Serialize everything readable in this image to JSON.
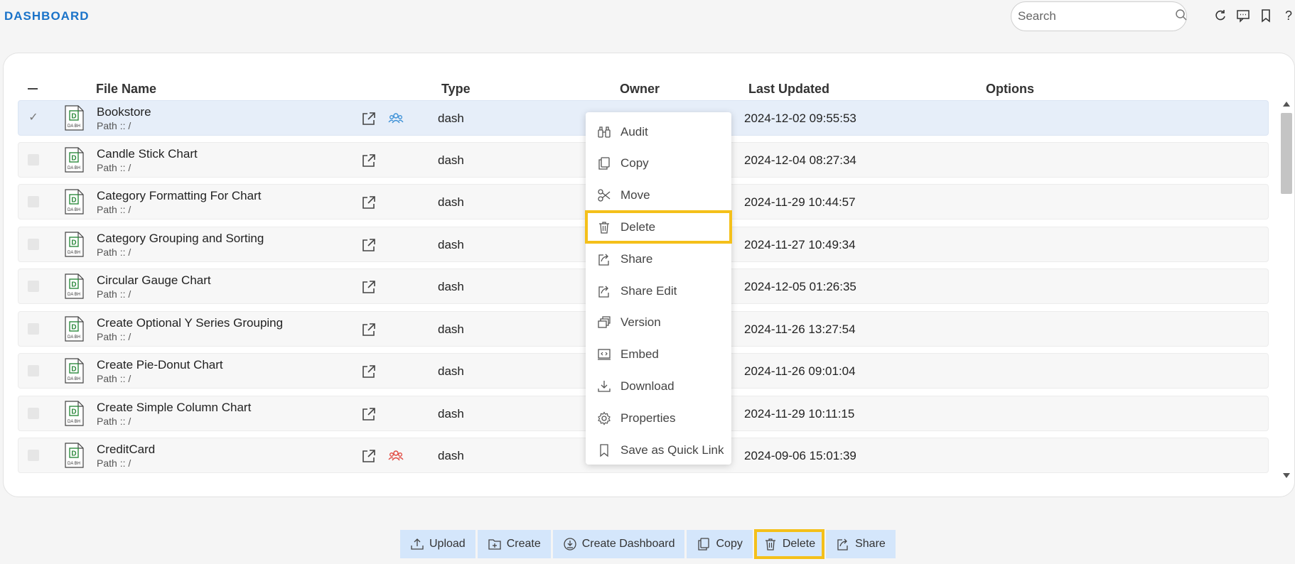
{
  "header": {
    "title": "DASHBOARD",
    "search_placeholder": "Search",
    "icons": [
      "refresh-icon",
      "comment-icon",
      "bookmark-icon",
      "help-icon"
    ]
  },
  "table": {
    "columns": {
      "file_name": "File Name",
      "type": "Type",
      "owner": "Owner",
      "last_updated": "Last Updated",
      "options": "Options"
    },
    "rows": [
      {
        "name": "Bookstore",
        "path": "Path :: /",
        "type": "dash",
        "updated": "2024-12-02 09:55:53",
        "selected": true,
        "shared": "blue"
      },
      {
        "name": "Candle Stick Chart",
        "path": "Path :: /",
        "type": "dash",
        "updated": "2024-12-04 08:27:34",
        "selected": false,
        "shared": ""
      },
      {
        "name": "Category Formatting For Chart",
        "path": "Path :: /",
        "type": "dash",
        "updated": "2024-11-29 10:44:57",
        "selected": false,
        "shared": ""
      },
      {
        "name": "Category Grouping and Sorting",
        "path": "Path :: /",
        "type": "dash",
        "updated": "2024-11-27 10:49:34",
        "selected": false,
        "shared": ""
      },
      {
        "name": "Circular Gauge Chart",
        "path": "Path :: /",
        "type": "dash",
        "updated": "2024-12-05 01:26:35",
        "selected": false,
        "shared": ""
      },
      {
        "name": "Create Optional Y Series Grouping",
        "path": "Path :: /",
        "type": "dash",
        "updated": "2024-11-26 13:27:54",
        "selected": false,
        "shared": ""
      },
      {
        "name": "Create Pie-Donut Chart",
        "path": "Path :: /",
        "type": "dash",
        "updated": "2024-11-26 09:01:04",
        "selected": false,
        "shared": ""
      },
      {
        "name": "Create Simple Column Chart",
        "path": "Path :: /",
        "type": "dash",
        "updated": "2024-11-29 10:11:15",
        "selected": false,
        "shared": ""
      },
      {
        "name": "CreditCard",
        "path": "Path :: /",
        "type": "dash",
        "updated": "2024-09-06 15:01:39",
        "selected": false,
        "shared": "red"
      }
    ],
    "file_icon_text": "DASH"
  },
  "context_menu": {
    "items": [
      "Audit",
      "Copy",
      "Move",
      "Delete",
      "Share",
      "Share Edit",
      "Version",
      "Embed",
      "Download",
      "Properties",
      "Save as Quick Link"
    ],
    "highlighted": "Delete"
  },
  "toolbar": {
    "buttons": [
      "Upload",
      "Create",
      "Create Dashboard",
      "Copy",
      "Delete",
      "Share"
    ],
    "highlighted": "Delete"
  },
  "colors": {
    "accent": "#1a73c9",
    "highlight": "#f4c01a",
    "toolbar_bg": "#d4e6fb",
    "selected_row": "#e6eef9",
    "share_blue": "#3a8fd6",
    "share_red": "#e0443c"
  }
}
